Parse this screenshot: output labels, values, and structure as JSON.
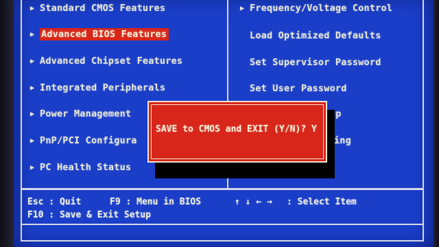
{
  "left_menu": [
    {
      "label": "Standard CMOS Features",
      "selected": false
    },
    {
      "label": "Advanced BIOS Features",
      "selected": true
    },
    {
      "label": "Advanced Chipset Features",
      "selected": false
    },
    {
      "label": "Integrated Peripherals",
      "selected": false
    },
    {
      "label": "Power Management",
      "selected": false
    },
    {
      "label": "PnP/PCI Configura",
      "selected": false
    },
    {
      "label": "PC Health Status",
      "selected": false
    }
  ],
  "right_menu": [
    {
      "label": "Frequency/Voltage Control",
      "has_arrow": true
    },
    {
      "label": "Load Optimized Defaults",
      "has_arrow": false
    },
    {
      "label": "Set Supervisor Password",
      "has_arrow": false
    },
    {
      "label": "Set User Password",
      "has_arrow": false
    },
    {
      "label": "Setup",
      "has_arrow": false
    },
    {
      "label": "Saving",
      "has_arrow": false
    }
  ],
  "arrow_glyph": "▶",
  "dialog": {
    "prompt": "SAVE to CMOS and EXIT (Y/N)? Y"
  },
  "help": {
    "line1_left": "Esc : Quit",
    "line1_mid": "F9 : Menu in BIOS",
    "line1_arrows": "↑ ↓ ← →",
    "line1_right": ": Select Item",
    "line2": "F10 : Save & Exit Setup"
  },
  "colors": {
    "background": "#1a3ec8",
    "highlight": "#d8261a",
    "text": "#e8e8d8"
  }
}
